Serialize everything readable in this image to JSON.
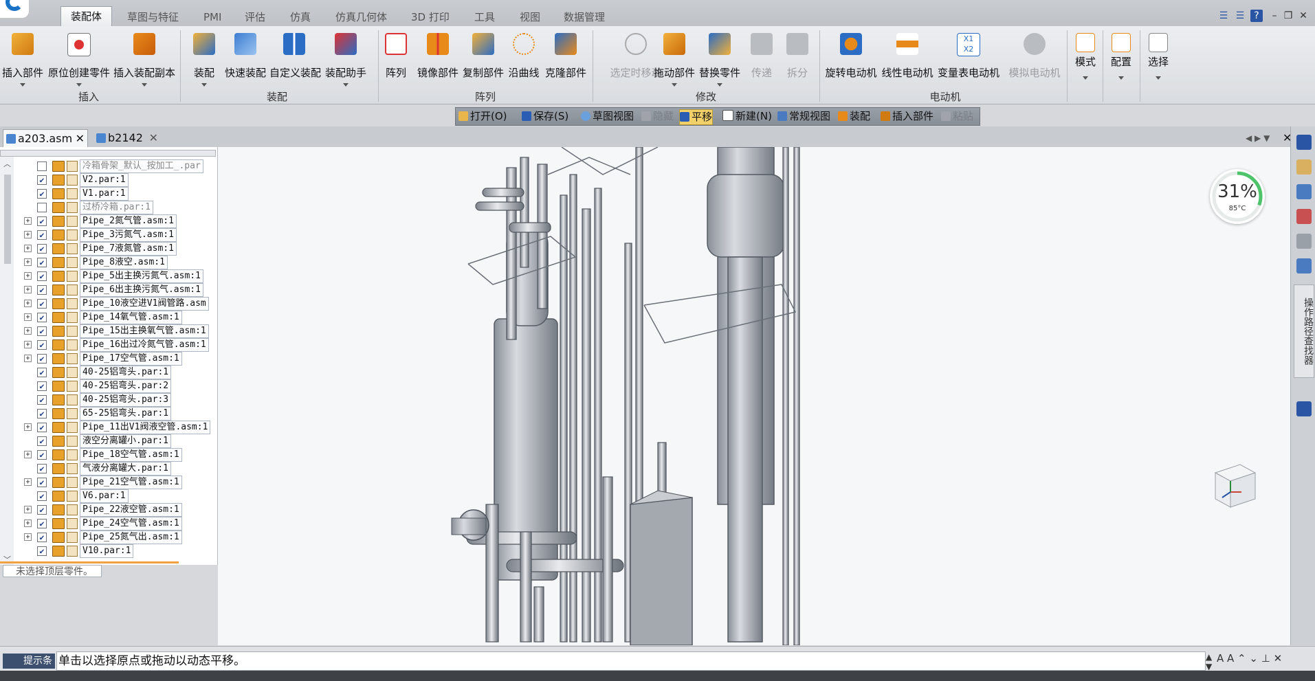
{
  "ribbon_tabs": [
    "装配体",
    "草图与特征",
    "PMI",
    "评估",
    "仿真",
    "仿真几何体",
    "3D 打印",
    "工具",
    "视图",
    "数据管理"
  ],
  "ribbon_buttons": {
    "insert_part": "插入部件",
    "create_in_place": "原位创建零件",
    "insert_copy": "插入装配副本",
    "assemble": "装配",
    "quick_assemble": "快速装配",
    "custom_assemble": "自定义装配",
    "assembly_assistant": "装配助手",
    "pattern": "阵列",
    "mirror": "镜像部件",
    "duplicate": "复制部件",
    "along_curve": "沿曲线",
    "clone": "克隆部件",
    "move_when_selected": "选定时移动",
    "drag_part": "拖动部件",
    "replace_part": "替换零件",
    "transfer": "传递",
    "disperse": "拆分",
    "rotary_motor": "旋转电动机",
    "linear_motor": "线性电动机",
    "table_motor": "变量表电动机",
    "simulate_motor": "模拟电动机",
    "mode": "模式",
    "configure": "配置",
    "select": "选择"
  },
  "ribbon_groups": {
    "insert": "插入",
    "assemble": "装配",
    "pattern": "阵列",
    "modify": "修改",
    "motor": "电动机"
  },
  "quick_toolbar": {
    "open": "打开(O)",
    "save": "保存(S)",
    "sketch_view": "草图视图",
    "hide": "隐藏",
    "pan": "平移",
    "new": "新建(N)",
    "normal_view": "常规视图",
    "assemble": "装配",
    "insert_part": "插入部件",
    "paste": "粘贴"
  },
  "doc_tabs": [
    "a203.asm",
    "b2142"
  ],
  "tree_items": [
    {
      "label": "冷箱骨架_默认_按加工_.par",
      "expand": false,
      "checked": false,
      "dim": true
    },
    {
      "label": "V2.par:1",
      "expand": false,
      "checked": true,
      "dim": false
    },
    {
      "label": "V1.par:1",
      "expand": false,
      "checked": true,
      "dim": false
    },
    {
      "label": "过桥冷箱.par:1",
      "expand": false,
      "checked": false,
      "dim": true
    },
    {
      "label": "Pipe_2氮气管.asm:1",
      "expand": true,
      "checked": true,
      "dim": false
    },
    {
      "label": "Pipe_3污氮气.asm:1",
      "expand": true,
      "checked": true,
      "dim": false
    },
    {
      "label": "Pipe_7液氮管.asm:1",
      "expand": true,
      "checked": true,
      "dim": false
    },
    {
      "label": "Pipe_8液空.asm:1",
      "expand": true,
      "checked": true,
      "dim": false
    },
    {
      "label": "Pipe_5出主换污氮气.asm:1",
      "expand": true,
      "checked": true,
      "dim": false
    },
    {
      "label": "Pipe_6出主换污氮气.asm:1",
      "expand": true,
      "checked": true,
      "dim": false
    },
    {
      "label": "Pipe_10液空进V1阀管路.asm",
      "expand": true,
      "checked": true,
      "dim": false
    },
    {
      "label": "Pipe_14氧气管.asm:1",
      "expand": true,
      "checked": true,
      "dim": false
    },
    {
      "label": "Pipe_15出主换氧气管.asm:1",
      "expand": true,
      "checked": true,
      "dim": false
    },
    {
      "label": "Pipe_16出过冷氮气管.asm:1",
      "expand": true,
      "checked": true,
      "dim": false
    },
    {
      "label": "Pipe_17空气管.asm:1",
      "expand": true,
      "checked": true,
      "dim": false
    },
    {
      "label": "40-25铝弯头.par:1",
      "expand": false,
      "checked": true,
      "dim": false
    },
    {
      "label": "40-25铝弯头.par:2",
      "expand": false,
      "checked": true,
      "dim": false
    },
    {
      "label": "40-25铝弯头.par:3",
      "expand": false,
      "checked": true,
      "dim": false
    },
    {
      "label": "65-25铝弯头.par:1",
      "expand": false,
      "checked": true,
      "dim": false
    },
    {
      "label": "Pipe_11出V1阀液空管.asm:1",
      "expand": true,
      "checked": true,
      "dim": false
    },
    {
      "label": "液空分离罐小.par:1",
      "expand": false,
      "checked": true,
      "dim": false
    },
    {
      "label": "Pipe_18空气管.asm:1",
      "expand": true,
      "checked": true,
      "dim": false
    },
    {
      "label": "气液分离罐大.par:1",
      "expand": false,
      "checked": true,
      "dim": false
    },
    {
      "label": "Pipe_21空气管.asm:1",
      "expand": true,
      "checked": true,
      "dim": false
    },
    {
      "label": "V6.par:1",
      "expand": false,
      "checked": true,
      "dim": false
    },
    {
      "label": "Pipe_22液空管.asm:1",
      "expand": true,
      "checked": true,
      "dim": false
    },
    {
      "label": "Pipe_24空气管.asm:1",
      "expand": true,
      "checked": true,
      "dim": false
    },
    {
      "label": "Pipe_25氮气出.asm:1",
      "expand": true,
      "checked": true,
      "dim": false
    },
    {
      "label": "V10.par:1",
      "expand": false,
      "checked": true,
      "dim": false
    }
  ],
  "tree_footer": "未选择顶层零件。",
  "gauge": {
    "percent": "31%",
    "temp": "85°C"
  },
  "side_panel_label": "操作路径查找器",
  "hint": {
    "label": "提示条",
    "text": "单击以选择原点或拖动以动态平移。"
  },
  "accent_color": "#f2d16a"
}
